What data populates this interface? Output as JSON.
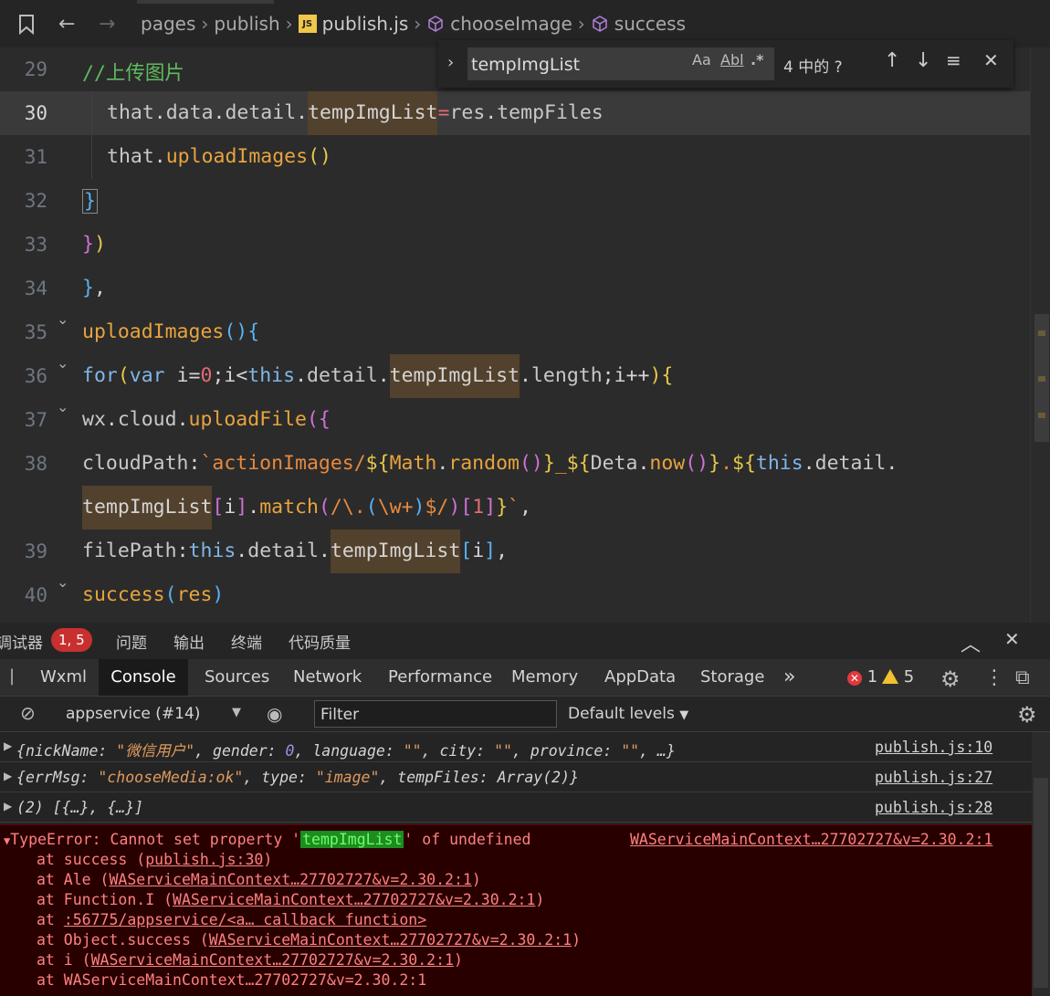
{
  "breadcrumb": {
    "segments": [
      "pages",
      "publish",
      "publish.js",
      "chooseImage",
      "success"
    ]
  },
  "editor": {
    "lines": [
      {
        "num": "29",
        "text": "//上传图片"
      },
      {
        "num": "30",
        "text": "that.data.detail.tempImgList=res.tempFiles"
      },
      {
        "num": "31",
        "text": "that.uploadImages()"
      },
      {
        "num": "32",
        "text": "}"
      },
      {
        "num": "33",
        "text": "})"
      },
      {
        "num": "34",
        "text": "},"
      },
      {
        "num": "35",
        "text": "uploadImages(){"
      },
      {
        "num": "36",
        "text": "for(var i=0;i<this.detail.tempImgList.length;i++){"
      },
      {
        "num": "37",
        "text": "wx.cloud.uploadFile({"
      },
      {
        "num": "38",
        "text": "cloudPath:`actionImages/${Math.random()}_${Deta.now()}.${this.detail."
      },
      {
        "num": "",
        "text": "tempImgList[i].match(/\\.(\\w+)$/)[1]}`,"
      },
      {
        "num": "39",
        "text": "filePath:this.detail.tempImgList[i],"
      },
      {
        "num": "40",
        "text": "success(res)"
      }
    ]
  },
  "find": {
    "query": "tempImgList",
    "match_case": "Aa",
    "whole_word": "Abl",
    "regex": ".*",
    "count": "4 中的 ?"
  },
  "panel": {
    "title": "调试器",
    "badge": "1, 5",
    "tabs": [
      "问题",
      "输出",
      "终端",
      "代码质量"
    ]
  },
  "devtools": {
    "tabs": [
      "Wxml",
      "Console",
      "Sources",
      "Network",
      "Performance",
      "Memory",
      "AppData",
      "Storage"
    ],
    "active_tab": "Console",
    "more": "»",
    "errors": "1",
    "warnings": "5"
  },
  "filterbar": {
    "context": "appservice (#14)",
    "filter_placeholder": "Filter",
    "levels": "Default levels"
  },
  "console": {
    "rows": [
      {
        "msg": "{nickName: \"微信用户\", gender: 0, language: \"\", city: \"\", province: \"\", …}",
        "src": "publish.js:10"
      },
      {
        "msg": "{errMsg: \"chooseMedia:ok\", type: \"image\", tempFiles: Array(2)}",
        "src": "publish.js:27"
      },
      {
        "msg": "(2) [{…}, {…}]",
        "src": "publish.js:28"
      }
    ],
    "error": {
      "prefix": "TypeError: Cannot set property '",
      "prop": "tempImgList",
      "suffix": "' of undefined",
      "src": "WAServiceMainContext…27702727&v=2.30.2:1",
      "stack": [
        {
          "pre": "at success (",
          "link": "publish.js:30",
          "post": ")"
        },
        {
          "pre": "at Ale (",
          "link": "WAServiceMainContext…27702727&v=2.30.2:1",
          "post": ")"
        },
        {
          "pre": "at Function.I (",
          "link": "WAServiceMainContext…27702727&v=2.30.2:1",
          "post": ")"
        },
        {
          "pre": "at ",
          "link": ":56775/appservice/<a… callback function>",
          "post": ""
        },
        {
          "pre": "at Object.success (",
          "link": "WAServiceMainContext…27702727&v=2.30.2:1",
          "post": ")"
        },
        {
          "pre": "at i (",
          "link": "WAServiceMainContext…27702727&v=2.30.2:1",
          "post": ")"
        },
        {
          "pre": "at WAServiceMainContext…27702727&v=2.30.2:1",
          "link": "",
          "post": ""
        }
      ]
    }
  }
}
